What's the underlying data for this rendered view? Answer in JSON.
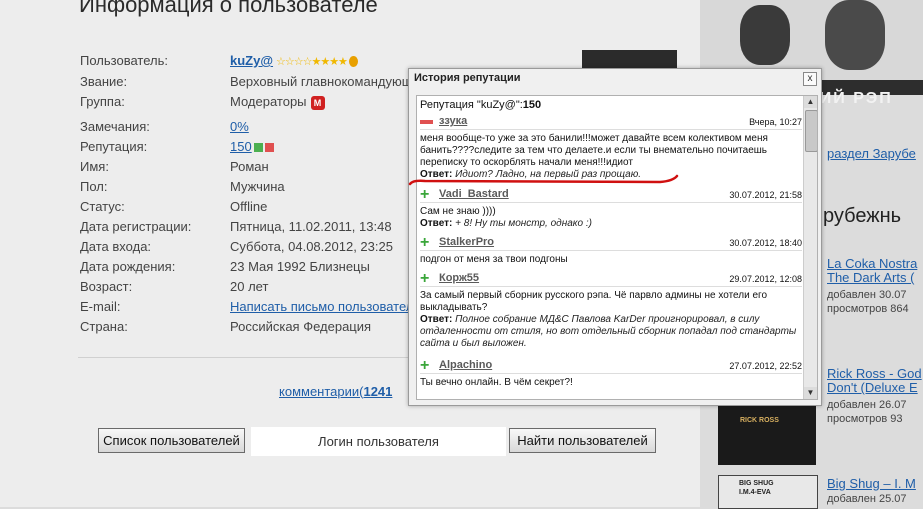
{
  "page": {
    "title": "Информация о пользователе"
  },
  "profile": {
    "rows": [
      {
        "label": "Пользователь:",
        "value": "kuZy@"
      },
      {
        "label": "Звание:",
        "value": "Верховный главнокомандующ"
      },
      {
        "label": "Группа:",
        "value": "Модераторы"
      },
      {
        "label": "Замечания:",
        "value": "0%"
      },
      {
        "label": "Репутация:",
        "value": "150"
      },
      {
        "label": "Имя:",
        "value": "Роман"
      },
      {
        "label": "Пол:",
        "value": "Мужчина"
      },
      {
        "label": "Статус:",
        "value": "Offline"
      },
      {
        "label": "Дата регистрации:",
        "value": "Пятница, 11.02.2011, 13:48"
      },
      {
        "label": "Дата входа:",
        "value": "Суббота, 04.08.2012, 23:25"
      },
      {
        "label": "Дата рождения:",
        "value": "23 Мая 1992 Близнецы"
      },
      {
        "label": "Возраст:",
        "value": "20 лет"
      },
      {
        "label": "E-mail:",
        "value": "Написать письмо пользовател"
      },
      {
        "label": "Страна:",
        "value": "Российская Федерация"
      }
    ],
    "stars": "☆☆☆☆★★★★",
    "group_icon": "М"
  },
  "comments": {
    "label": "комментарии(",
    "count": "1241"
  },
  "search": {
    "list_button": "Список пользователей",
    "login_placeholder": "Логин пользователя",
    "find_button": "Найти пользователей"
  },
  "popup": {
    "title": "История репутации",
    "close": "x",
    "total_label": "Репутация \"kuZy@\":",
    "total_value": "150",
    "entries": [
      {
        "user": "ззука",
        "sign": "minus",
        "date": "Вчера, 10:27",
        "text": "меня вообще-то уже за это банили!!!может давайте всем колективом меня банить????следите за тем что делаете.и если ты внемательно почитаешь переписку то оскорблять начали меня!!!идиот",
        "answer_label": "Ответ:",
        "answer": "Идиот? Ладно, на первый раз прощаю."
      },
      {
        "user": "Vadi_Bastard",
        "sign": "plus",
        "date": "30.07.2012, 21:58",
        "text": "Сам не знаю ))))",
        "answer_label": "Ответ:",
        "answer": "+ 8! Ну ты монстр, однако :)"
      },
      {
        "user": "StalkerPro",
        "sign": "plus",
        "date": "30.07.2012, 18:40",
        "text": "подгон от меня за твои подгоны",
        "answer_label": "",
        "answer": ""
      },
      {
        "user": "Корж55",
        "sign": "plus",
        "date": "29.07.2012, 12:08",
        "text": "За самый первый сборник русского рэпа. Чё парвло админы не хотели его выкладывать?",
        "answer_label": "Ответ:",
        "answer": "Полное собрание МД&С Павлова KarDer проигнорировал, в силу отдаленности от стиля, но вот отдельный сборник попадал под стандарты сайта и был выложен."
      },
      {
        "user": "Alpachino",
        "sign": "plus",
        "date": "27.07.2012, 22:52",
        "text": "Ты вечно онлайн. В чём секрет?!",
        "answer_label": "",
        "answer": ""
      }
    ]
  },
  "sidebar": {
    "banner_text": "КИЙ РЭП",
    "section_link": "раздел Зарубе",
    "heading": "рубежнь",
    "items": [
      {
        "title1": "La Coka Nostra",
        "title2": "The Dark Arts (",
        "added": "добавлен 30.07",
        "views": "просмотров 864"
      },
      {
        "title1": "Rick Ross - God",
        "title2": "Don't (Deluxe E",
        "added": "добавлен 26.07",
        "views": "просмотров 93"
      },
      {
        "title1": "Big Shug – I. M",
        "title2": "",
        "added": "добавлен 25.07",
        "views": ""
      }
    ],
    "thumb_labels": [
      "RICK ROSS",
      "BIG SHUG",
      "I.M.4-EVA"
    ]
  },
  "colors": {
    "link": "#1f5ea8",
    "annotation": "#d01010",
    "plus": "#3aa63a",
    "minus": "#e05050"
  }
}
